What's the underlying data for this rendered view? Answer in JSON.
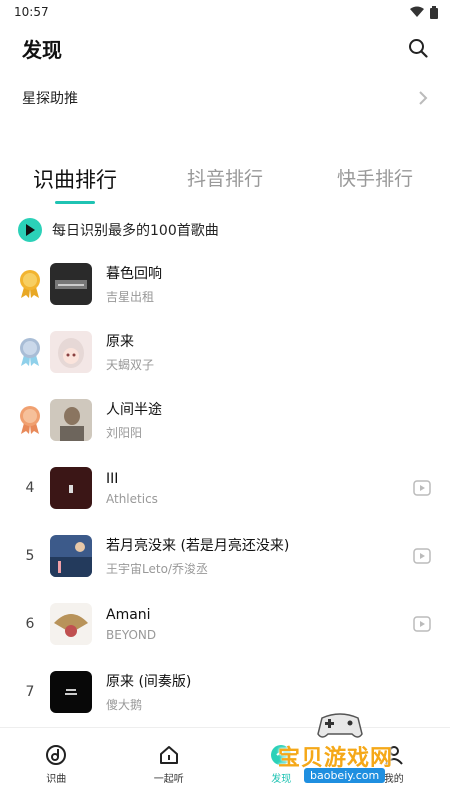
{
  "status": {
    "time": "10:57"
  },
  "header": {
    "title": "发现"
  },
  "assistant": {
    "label": "星探助推"
  },
  "tabs": [
    {
      "label": "识曲排行",
      "active": true
    },
    {
      "label": "抖音排行",
      "active": false
    },
    {
      "label": "快手排行",
      "active": false
    }
  ],
  "play_all": {
    "label": "每日识别最多的100首歌曲"
  },
  "songs": [
    {
      "rank": "1",
      "title": "暮色回响",
      "artist": "吉星出租",
      "medal": "gold",
      "video": false
    },
    {
      "rank": "2",
      "title": "原来",
      "artist": "天蝎双子",
      "medal": "silver",
      "video": false
    },
    {
      "rank": "3",
      "title": "人间半途",
      "artist": "刘阳阳",
      "medal": "bronze",
      "video": false
    },
    {
      "rank": "4",
      "title": "III",
      "artist": "Athletics",
      "medal": "",
      "video": true
    },
    {
      "rank": "5",
      "title": "若月亮没来 (若是月亮还没来)",
      "artist": "王宇宙Leto/乔浚丞",
      "medal": "",
      "video": true
    },
    {
      "rank": "6",
      "title": "Amani",
      "artist": "BEYOND",
      "medal": "",
      "video": true
    },
    {
      "rank": "7",
      "title": "原来 (间奏版)",
      "artist": "傻大鹅",
      "medal": "",
      "video": false
    }
  ],
  "bottom_nav": [
    {
      "label": "识曲",
      "icon": "music-note-icon",
      "active": false
    },
    {
      "label": "一起听",
      "icon": "home-icon",
      "active": false
    },
    {
      "label": "发现",
      "icon": "discover-icon",
      "active": true
    },
    {
      "label": "我的",
      "icon": "profile-icon",
      "active": false
    }
  ],
  "watermark": {
    "text": "宝贝游戏网",
    "url": "baobeiy.com"
  },
  "colors": {
    "accent": "#1fc3b3",
    "gold": "#f2b430",
    "silver": "#a9bdd6",
    "bronze": "#f0a070"
  }
}
